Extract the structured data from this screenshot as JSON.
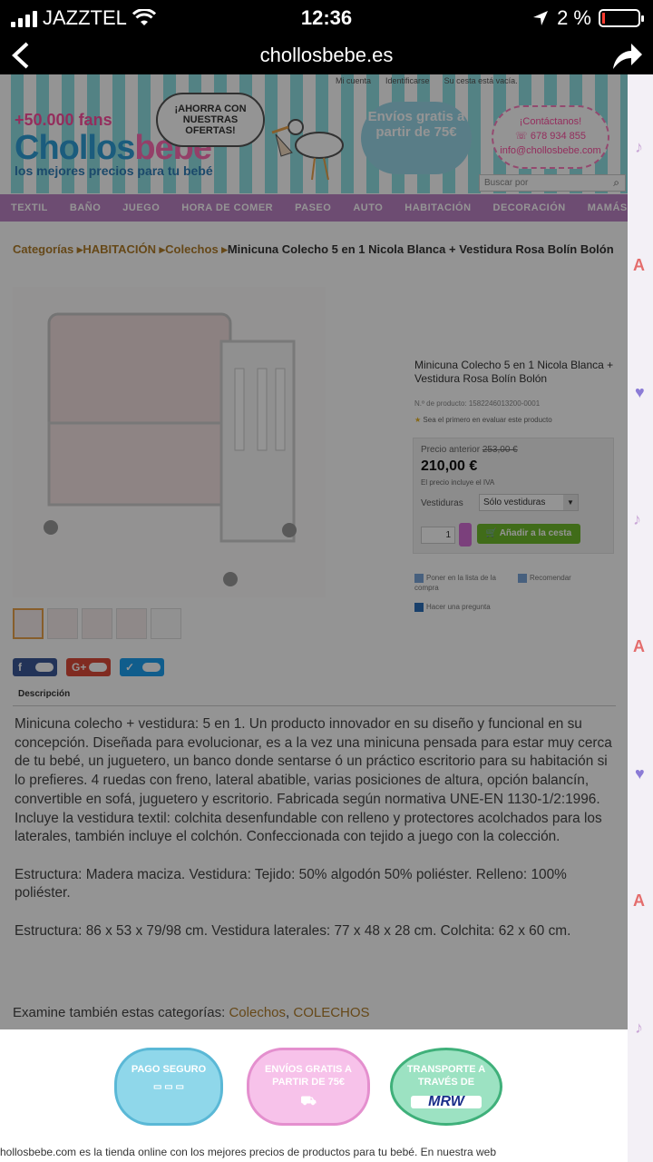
{
  "status": {
    "carrier": "JAZZTEL",
    "time": "12:36",
    "battery": "2 %"
  },
  "nav": {
    "domain": "chollosbebe.es"
  },
  "header": {
    "toplinks": [
      "Mi cuenta",
      "Identificarse",
      "Su cesta está vacía."
    ],
    "fans": "+50.000 fans",
    "logo_a": "Chollos",
    "logo_b": "bebé",
    "slogan": "los mejores precios para tu bebé",
    "bubble": "¡AHORRA CON NUESTRAS OFERTAS!",
    "shipping": "Envíos gratis a partir de 75€",
    "contact_title": "¡Contáctanos!",
    "phone": "678 934 855",
    "email": "info@chollosbebe.com",
    "search_placeholder": "Buscar por"
  },
  "menu": [
    "TEXTIL",
    "BAÑO",
    "JUEGO",
    "HORA DE COMER",
    "PASEO",
    "AUTO",
    "HABITACIÓN",
    "DECORACIÓN",
    "MAMÁS"
  ],
  "breadcrumb": {
    "c1": "Categorías",
    "c2": "HABITACIÓN",
    "c3": "Colechos",
    "current": "Minicuna Colecho 5 en 1 Nicola Blanca + Vestidura Rosa Bolín Bolón"
  },
  "product": {
    "name": "Minicuna Colecho 5 en 1 Nicola Blanca + Vestidura Rosa Bolín Bolón",
    "ref": "N.º de producto: 1582246013200-0001",
    "rating": "Sea el primero en evaluar este producto",
    "prev_label": "Precio anterior",
    "prev_price": "253,00 €",
    "price": "210,00 €",
    "iva": "El precio incluye el IVA",
    "vestiduras_label": "Vestiduras",
    "vestiduras_value": "Sólo vestiduras",
    "qty": "1",
    "add_to_cart": "Añadir a la cesta",
    "wishlist": "Poner en la lista de la compra",
    "recommend": "Recomendar",
    "ask": "Hacer una pregunta"
  },
  "tabs": {
    "description": "Descripción"
  },
  "description": {
    "p1": "Minicuna colecho + vestidura: 5 en 1. Un producto innovador en su diseño y funcional en su concepción. Diseñada para evolucionar, es a la vez una minicuna pensada para estar muy cerca de tu bebé, un juguetero, un banco donde sentarse ó un práctico escritorio para su habitación si lo prefieres. 4 ruedas con freno, lateral abatible, varias posiciones de altura, opción balancín, convertible en sofá, juguetero y escritorio. Fabricada según normativa UNE-EN 1130-1/2:1996. Incluye la vestidura textil: colchita desenfundable con relleno y protectores acolchados para los laterales, también incluye el colchón. Confeccionada con tejido a juego con la colección.",
    "p2": "Estructura: Madera maciza. Vestidura: Tejido: 50% algodón 50% poliéster. Relleno: 100% poliéster.",
    "p3": "Estructura: 86 x 53 x 79/98 cm. Vestidura laterales: 77 x 48 x 28 cm. Colchita: 62 x 60 cm."
  },
  "also": {
    "label": "Examine también estas categorías:",
    "cat1": "Colechos",
    "cat2": "COLECHOS"
  },
  "badges": {
    "pay": "PAGO SEGURO",
    "ship": "ENVÍOS GRATIS A PARTIR DE 75€",
    "mrw_title": "TRANSPORTE A TRAVÉS DE",
    "mrw": "MRW"
  },
  "footer": "hollosbebe.com es la tienda online con los mejores precios de productos para tu bebé. En nuestra web",
  "colors": {
    "accent_menu": "#bc83c4",
    "cart_button": "#6fbb2c",
    "link": "#b07d2a"
  }
}
